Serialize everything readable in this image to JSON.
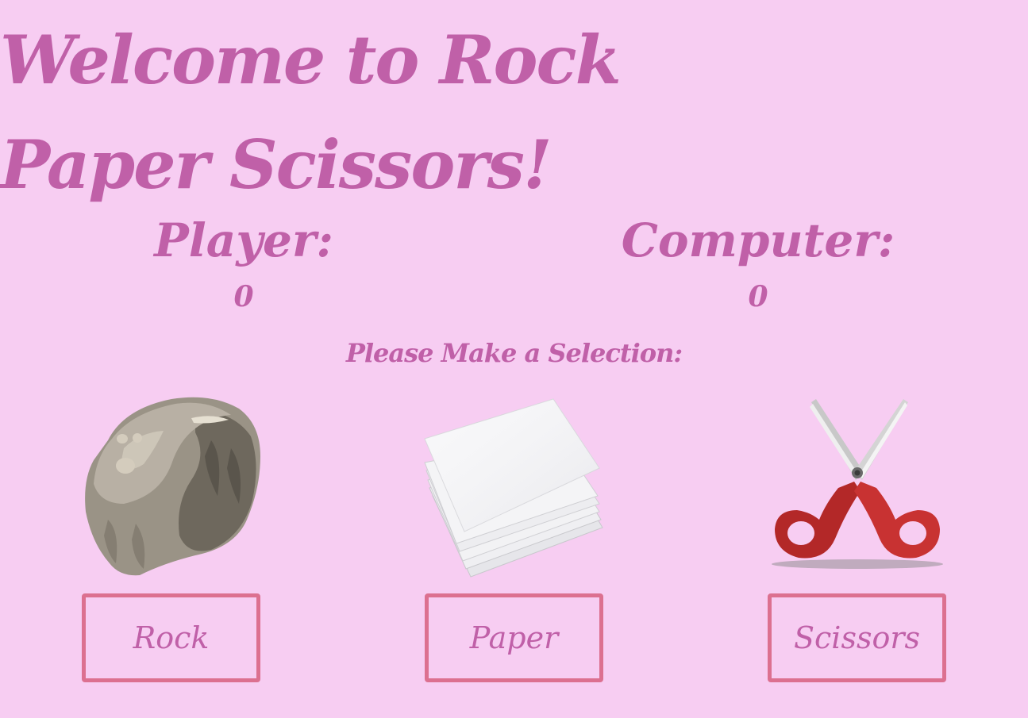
{
  "header": {
    "title": "Welcome to Rock Paper Scissors!"
  },
  "scoreboard": {
    "player_label": "Player:",
    "player_score": "0",
    "computer_label": "Computer:",
    "computer_score": "0"
  },
  "prompt": "Please Make a Selection:",
  "choices": [
    {
      "label": "Rock",
      "icon": "rock-icon"
    },
    {
      "label": "Paper",
      "icon": "paper-stack-icon"
    },
    {
      "label": "Scissors",
      "icon": "scissors-icon"
    }
  ],
  "colors": {
    "background": "#f7cdf2",
    "text": "#c060a8",
    "button_border": "#dc7090"
  }
}
